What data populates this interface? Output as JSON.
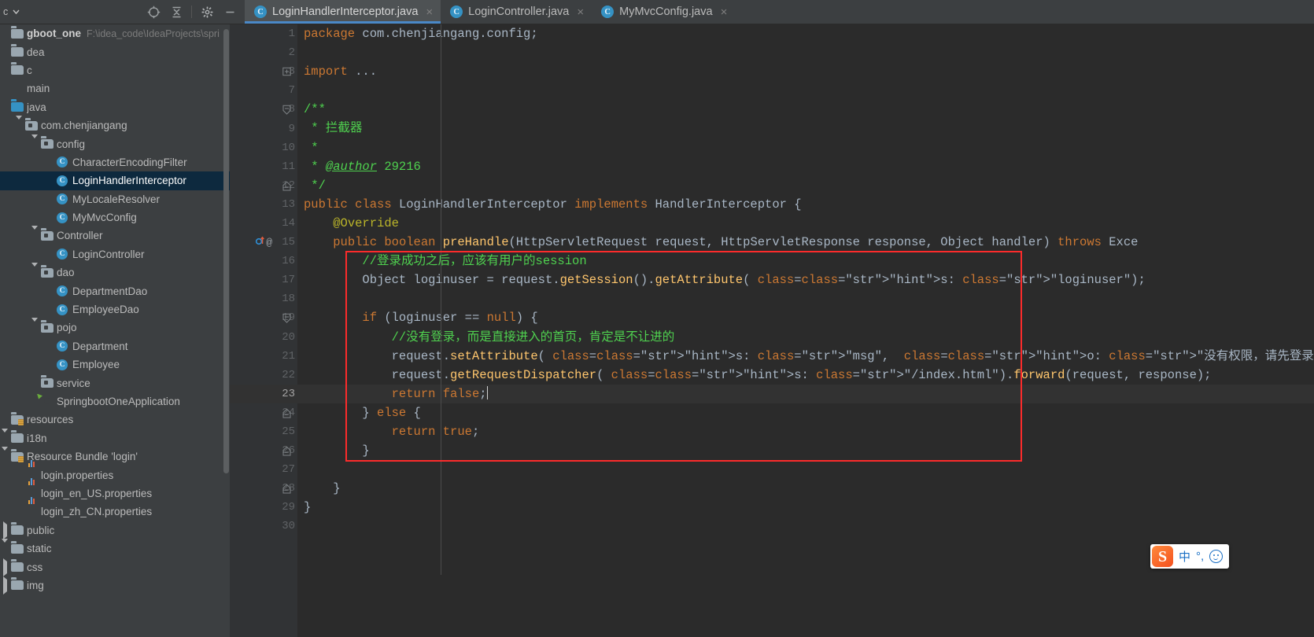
{
  "window": {
    "project_panel_label": "c",
    "toolbar_icons": [
      "locate-crosshair-icon",
      "collapse-all-icon",
      "settings-gear-icon",
      "minimize-icon"
    ]
  },
  "tabs": [
    {
      "label": "LoginHandlerInterceptor.java",
      "icon": "java-class-icon",
      "active": true,
      "close": "×"
    },
    {
      "label": "LoginController.java",
      "icon": "java-class-icon",
      "active": false,
      "close": "×"
    },
    {
      "label": "MyMvcConfig.java",
      "icon": "java-class-icon",
      "active": false,
      "close": "×"
    }
  ],
  "project_tree": [
    {
      "label": "gboot_one",
      "path": "F:\\idea_code\\IdeaProjects\\spri",
      "icon": "project-icon",
      "indent": 0,
      "arrow": "none",
      "bold": true,
      "selected": false
    },
    {
      "label": "dea",
      "icon": "folder-icon",
      "indent": 0,
      "arrow": "none",
      "selected": false
    },
    {
      "label": "c",
      "icon": "folder-icon",
      "indent": 0,
      "arrow": "none",
      "selected": false
    },
    {
      "label": "main",
      "icon": "module-icon",
      "indent": 0,
      "arrow": "none",
      "selected": false
    },
    {
      "label": "java",
      "icon": "source-folder-icon",
      "indent": 1,
      "arrow": "none",
      "selected": false
    },
    {
      "label": "com.chenjiangang",
      "icon": "package-icon",
      "indent": 2,
      "arrow": "open",
      "selected": false
    },
    {
      "label": "config",
      "icon": "package-icon",
      "indent": 3,
      "arrow": "open",
      "selected": false
    },
    {
      "label": "CharacterEncodingFilter",
      "icon": "java-class-icon",
      "indent": 4,
      "arrow": "none",
      "selected": false
    },
    {
      "label": "LoginHandlerInterceptor",
      "icon": "java-class-icon",
      "indent": 4,
      "arrow": "none",
      "selected": true
    },
    {
      "label": "MyLocaleResolver",
      "icon": "java-class-icon",
      "indent": 4,
      "arrow": "none",
      "selected": false
    },
    {
      "label": "MyMvcConfig",
      "icon": "java-class-icon",
      "indent": 4,
      "arrow": "none",
      "selected": false
    },
    {
      "label": "Controller",
      "icon": "package-icon",
      "indent": 3,
      "arrow": "open",
      "selected": false
    },
    {
      "label": "LoginController",
      "icon": "java-class-icon",
      "indent": 4,
      "arrow": "none",
      "selected": false
    },
    {
      "label": "dao",
      "icon": "package-icon",
      "indent": 3,
      "arrow": "open",
      "selected": false
    },
    {
      "label": "DepartmentDao",
      "icon": "java-class-icon",
      "indent": 4,
      "arrow": "none",
      "selected": false
    },
    {
      "label": "EmployeeDao",
      "icon": "java-class-icon",
      "indent": 4,
      "arrow": "none",
      "selected": false
    },
    {
      "label": "pojo",
      "icon": "package-icon",
      "indent": 3,
      "arrow": "open",
      "selected": false
    },
    {
      "label": "Department",
      "icon": "java-class-icon",
      "indent": 4,
      "arrow": "none",
      "selected": false
    },
    {
      "label": "Employee",
      "icon": "java-class-icon",
      "indent": 4,
      "arrow": "none",
      "selected": false
    },
    {
      "label": "service",
      "icon": "package-icon",
      "indent": 3,
      "arrow": "none",
      "selected": false
    },
    {
      "label": "SpringbootOneApplication",
      "icon": "spring-boot-run-icon",
      "indent": 3,
      "arrow": "none",
      "selected": false
    },
    {
      "label": "resources",
      "icon": "resources-folder-icon",
      "indent": 0,
      "arrow": "none",
      "selected": false
    },
    {
      "label": "i18n",
      "icon": "folder-icon",
      "indent": 0,
      "arrow": "open",
      "selected": false
    },
    {
      "label": "Resource Bundle 'login'",
      "icon": "resource-bundle-icon",
      "indent": 1,
      "arrow": "open",
      "selected": false
    },
    {
      "label": "login.properties",
      "icon": "properties-file-icon",
      "indent": 2,
      "arrow": "none",
      "selected": false
    },
    {
      "label": "login_en_US.properties",
      "icon": "properties-file-icon",
      "indent": 2,
      "arrow": "none",
      "selected": false
    },
    {
      "label": "login_zh_CN.properties",
      "icon": "properties-file-icon",
      "indent": 2,
      "arrow": "none",
      "selected": false
    },
    {
      "label": "public",
      "icon": "folder-icon",
      "indent": 0,
      "arrow": "closed",
      "selected": false
    },
    {
      "label": "static",
      "icon": "folder-icon",
      "indent": 0,
      "arrow": "open",
      "selected": false
    },
    {
      "label": "css",
      "icon": "folder-icon",
      "indent": 1,
      "arrow": "closed",
      "selected": false
    },
    {
      "label": "img",
      "icon": "folder-icon",
      "indent": 1,
      "arrow": "closed",
      "selected": false
    }
  ],
  "editor": {
    "current_line": 23,
    "line_numbers": [
      1,
      2,
      3,
      7,
      8,
      9,
      10,
      11,
      12,
      13,
      14,
      15,
      16,
      17,
      18,
      19,
      20,
      21,
      22,
      23,
      24,
      25,
      26,
      27,
      28,
      29,
      30
    ],
    "gutter_markers": {
      "15": [
        "override-implement-icon",
        "annotation-at-icon"
      ]
    },
    "fold_lines": [
      3,
      8,
      12,
      19,
      24,
      26,
      28
    ],
    "highlight_box": {
      "color": "#fc2b2b",
      "from_line": 16,
      "to_line": 26
    },
    "lines": [
      {
        "n": 1,
        "text": "package com.chenjiangang.config;"
      },
      {
        "n": 2,
        "text": ""
      },
      {
        "n": 3,
        "text": "import ..."
      },
      {
        "n": 7,
        "text": ""
      },
      {
        "n": 8,
        "text": "/**"
      },
      {
        "n": 9,
        "text": " * 拦截器"
      },
      {
        "n": 10,
        "text": " *"
      },
      {
        "n": 11,
        "text": " * @author 29216"
      },
      {
        "n": 12,
        "text": " */"
      },
      {
        "n": 13,
        "text": "public class LoginHandlerInterceptor implements HandlerInterceptor {"
      },
      {
        "n": 14,
        "text": "    @Override"
      },
      {
        "n": 15,
        "text": "    public boolean preHandle(HttpServletRequest request, HttpServletResponse response, Object handler) throws Exce"
      },
      {
        "n": 16,
        "text": "        //登录成功之后，应该有用户的session"
      },
      {
        "n": 17,
        "text": "        Object loginuser = request.getSession().getAttribute( s: \"loginuser\");"
      },
      {
        "n": 18,
        "text": ""
      },
      {
        "n": 19,
        "text": "        if (loginuser == null) {"
      },
      {
        "n": 20,
        "text": "            //没有登录，而是直接进入的首页，肯定是不让进的"
      },
      {
        "n": 21,
        "text": "            request.setAttribute( s: \"msg\",  o: \"没有权限，请先登录\");"
      },
      {
        "n": 22,
        "text": "            request.getRequestDispatcher( s: \"/index.html\").forward(request, response);"
      },
      {
        "n": 23,
        "text": "            return false;"
      },
      {
        "n": 24,
        "text": "        } else {"
      },
      {
        "n": 25,
        "text": "            return true;"
      },
      {
        "n": 26,
        "text": "        }"
      },
      {
        "n": 27,
        "text": ""
      },
      {
        "n": 28,
        "text": "    }"
      },
      {
        "n": 29,
        "text": "}"
      },
      {
        "n": 30,
        "text": ""
      }
    ]
  },
  "ime": {
    "logo_letter": "S",
    "mode_label": "中",
    "punct_label": "°,",
    "emoji_icon": "smiley-icon"
  },
  "colors": {
    "accent_blue": "#4a88c7",
    "selection_blue": "#0d293e",
    "highlight_red": "#fc2b2b",
    "keyword_orange": "#cc7832",
    "comment_green": "#4fd24f",
    "string_green": "#6a8759",
    "editor_bg": "#2b2b2b",
    "panel_bg": "#3c3f41"
  }
}
